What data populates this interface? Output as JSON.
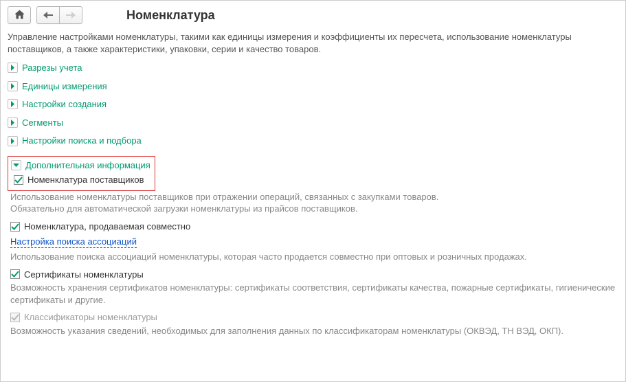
{
  "header": {
    "title": "Номенклатура",
    "icons": {
      "home": "home-icon",
      "prev": "arrow-left-icon",
      "next": "arrow-right-icon"
    }
  },
  "description": "Управление настройками номенклатуры, такими как единицы измерения и коэффициенты их пересчета, использование номенклатуры поставщиков, а также характеристики, упаковки, серии и качество товаров.",
  "sections": {
    "accounting_dimensions": {
      "label": "Разрезы учета",
      "expanded": false
    },
    "units": {
      "label": "Единицы измерения",
      "expanded": false
    },
    "creation_settings": {
      "label": "Настройки создания",
      "expanded": false
    },
    "segments": {
      "label": "Сегменты",
      "expanded": false
    },
    "search_settings": {
      "label": "Настройки поиска и подбора",
      "expanded": false
    },
    "additional_info": {
      "label": "Дополнительная информация",
      "expanded": true
    }
  },
  "additional_info": {
    "supplier_nomenclature": {
      "label": "Номенклатура поставщиков",
      "checked": true,
      "hint": "Использование номенклатуры поставщиков при отражении операций, связанных с закупками товаров.\nОбязательно для автоматической загрузки номенклатуры из прайсов поставщиков."
    },
    "joint_sales": {
      "label": "Номенклатура, продаваемая совместно",
      "checked": true
    },
    "association_search_link": {
      "label": "Настройка поиска ассоциаций",
      "hint": "Использование поиска ассоциаций номенклатуры, которая часто продается совместно при оптовых и розничных продажах."
    },
    "certificates": {
      "label": "Сертификаты номенклатуры",
      "checked": true,
      "hint": "Возможность хранения сертификатов номенклатуры: сертификаты соответствия, сертификаты качества, пожарные сертификаты, гигиенические сертификаты и другие."
    },
    "classifiers": {
      "label": "Классификаторы номенклатуры",
      "checked": true,
      "disabled": true,
      "hint": "Возможность указания сведений, необходимых для заполнения данных по классификаторам номенклатуры (ОКВЭД, ТН ВЭД, ОКП)."
    }
  }
}
